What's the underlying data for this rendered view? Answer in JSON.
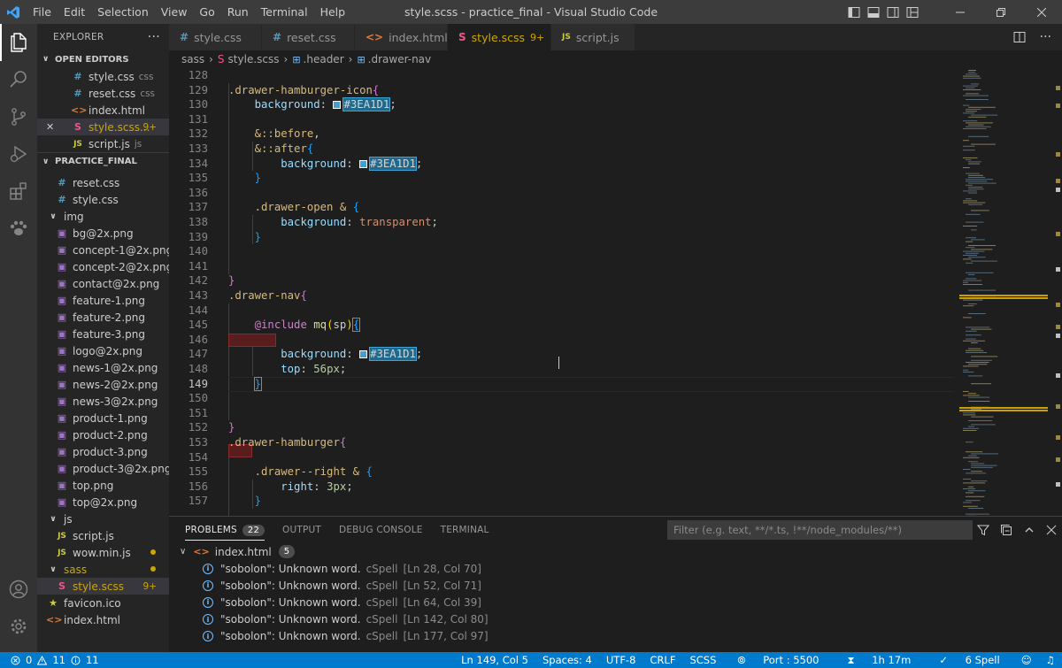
{
  "menu": [
    "File",
    "Edit",
    "Selection",
    "View",
    "Go",
    "Run",
    "Terminal",
    "Help"
  ],
  "window_title": "style.scss - practice_final - Visual Studio Code",
  "explorer": {
    "title": "EXPLORER",
    "more": "···",
    "open_editors_label": "OPEN EDITORS",
    "open_editors": [
      {
        "icon": "#",
        "name": "style.css",
        "sub": "css",
        "type": "css"
      },
      {
        "icon": "#",
        "name": "reset.css",
        "sub": "css",
        "type": "css"
      },
      {
        "icon": "<>",
        "name": "index.html",
        "sub": "",
        "type": "html"
      },
      {
        "icon": "S",
        "name": "style.scss...",
        "sub": "",
        "type": "sass",
        "badge": "9+",
        "close": "✕"
      },
      {
        "icon": "JS",
        "name": "script.js",
        "sub": "js",
        "type": "js"
      }
    ],
    "project_label": "PRACTICE_FINAL",
    "files": [
      {
        "icon": "#",
        "name": "reset.css",
        "type": "css",
        "indent": 1
      },
      {
        "icon": "#",
        "name": "style.css",
        "type": "css",
        "indent": 1
      },
      {
        "icon": "∨",
        "name": "img",
        "type": "folder",
        "indent": 0
      },
      {
        "icon": "▣",
        "name": "bg@2x.png",
        "type": "img",
        "indent": 1
      },
      {
        "icon": "▣",
        "name": "concept-1@2x.png",
        "type": "img",
        "indent": 1
      },
      {
        "icon": "▣",
        "name": "concept-2@2x.png",
        "type": "img",
        "indent": 1
      },
      {
        "icon": "▣",
        "name": "contact@2x.png",
        "type": "img",
        "indent": 1
      },
      {
        "icon": "▣",
        "name": "feature-1.png",
        "type": "img",
        "indent": 1
      },
      {
        "icon": "▣",
        "name": "feature-2.png",
        "type": "img",
        "indent": 1
      },
      {
        "icon": "▣",
        "name": "feature-3.png",
        "type": "img",
        "indent": 1
      },
      {
        "icon": "▣",
        "name": "logo@2x.png",
        "type": "img",
        "indent": 1
      },
      {
        "icon": "▣",
        "name": "news-1@2x.png",
        "type": "img",
        "indent": 1
      },
      {
        "icon": "▣",
        "name": "news-2@2x.png",
        "type": "img",
        "indent": 1
      },
      {
        "icon": "▣",
        "name": "news-3@2x.png",
        "type": "img",
        "indent": 1
      },
      {
        "icon": "▣",
        "name": "product-1.png",
        "type": "img",
        "indent": 1
      },
      {
        "icon": "▣",
        "name": "product-2.png",
        "type": "img",
        "indent": 1
      },
      {
        "icon": "▣",
        "name": "product-3.png",
        "type": "img",
        "indent": 1
      },
      {
        "icon": "▣",
        "name": "product-3@2x.png",
        "type": "img",
        "indent": 1
      },
      {
        "icon": "▣",
        "name": "top.png",
        "type": "img",
        "indent": 1
      },
      {
        "icon": "▣",
        "name": "top@2x.png",
        "type": "img",
        "indent": 1
      },
      {
        "icon": "∨",
        "name": "js",
        "type": "folder",
        "indent": 0
      },
      {
        "icon": "JS",
        "name": "script.js",
        "type": "js",
        "indent": 1
      },
      {
        "icon": "JS",
        "name": "wow.min.js",
        "type": "js",
        "indent": 1,
        "dot": true
      },
      {
        "icon": "∨",
        "name": "sass",
        "type": "folder",
        "indent": 0,
        "warn": true
      },
      {
        "icon": "S",
        "name": "style.scss",
        "type": "sass",
        "indent": 1,
        "badge": "9+",
        "selected": true
      },
      {
        "icon": "★",
        "name": "favicon.ico",
        "type": "star",
        "indent": 0
      },
      {
        "icon": "<>",
        "name": "index.html",
        "type": "html",
        "indent": 0
      }
    ]
  },
  "tabs": [
    {
      "icon": "#",
      "label": "style.css",
      "type": "css"
    },
    {
      "icon": "#",
      "label": "reset.css",
      "type": "css"
    },
    {
      "icon": "<>",
      "label": "index.html",
      "type": "html"
    },
    {
      "icon": "S",
      "label": "style.scss",
      "type": "sass",
      "badge": "9+",
      "active": true
    },
    {
      "icon": "JS",
      "label": "script.js",
      "type": "js"
    }
  ],
  "breadcrumb": [
    "sass",
    "style.scss",
    ".header",
    ".drawer-nav"
  ],
  "code_lines": [
    {
      "n": "128",
      "html": ""
    },
    {
      "n": "129",
      "html": "<span class='t-sel'>.drawer-hamburger-icon</span><span class='t-br'>{</span>"
    },
    {
      "n": "130",
      "html": "    <span class='t-prop'>background</span><span class='t-pl'>: </span><span class='swatch'></span><span class='hex'>#3EA1D1</span><span class='t-pl'>;</span>"
    },
    {
      "n": "131",
      "html": ""
    },
    {
      "n": "132",
      "html": "    <span class='t-sel'>&amp;::before</span><span class='t-pl'>,</span>"
    },
    {
      "n": "133",
      "html": "    <span class='t-sel'>&amp;::after</span><span class='t-br2'>{</span>"
    },
    {
      "n": "134",
      "html": "        <span class='t-prop'>background</span><span class='t-pl'>: </span><span class='swatch'></span><span class='hex'>#3EA1D1</span><span class='t-pl'>;</span>"
    },
    {
      "n": "135",
      "html": "    <span class='t-br2'>}</span>"
    },
    {
      "n": "136",
      "html": ""
    },
    {
      "n": "137",
      "html": "    <span class='t-sel'>.drawer-open &amp; </span><span class='t-br2'>{</span>"
    },
    {
      "n": "138",
      "html": "        <span class='t-prop'>background</span><span class='t-pl'>: </span><span class='t-val'>transparent</span><span class='t-pl'>;</span>"
    },
    {
      "n": "139",
      "html": "    <span class='t-br2'>}</span>"
    },
    {
      "n": "140",
      "html": ""
    },
    {
      "n": "141",
      "html": ""
    },
    {
      "n": "142",
      "html": "<span class='t-br'>}</span>"
    },
    {
      "n": "143",
      "html": "<span class='t-sel'>.drawer-nav</span><span class='t-br'>{</span>"
    },
    {
      "n": "144",
      "html": ""
    },
    {
      "n": "145",
      "html": "    <span class='t-kw'>@include</span><span class='t-pl'> </span><span class='t-fn'>mq</span><span class='t-br3'>(</span><span class='t-pl'>sp</span><span class='t-br3'>)</span><span class='t-br2' style='outline:1px solid #888'>{</span>"
    },
    {
      "n": "146",
      "html": ""
    },
    {
      "n": "147",
      "html": "        <span class='t-prop'>background</span><span class='t-pl'>: </span><span class='swatch'></span><span class='hex'>#3EA1D1</span><span class='t-pl'>;</span>"
    },
    {
      "n": "148",
      "html": "        <span class='t-prop'>top</span><span class='t-pl'>: </span><span class='t-num'>56px</span><span class='t-pl'>;</span>"
    },
    {
      "n": "149",
      "html": "    <span class='t-br2' style='outline:1px solid #888'>}</span>"
    },
    {
      "n": "150",
      "html": ""
    },
    {
      "n": "151",
      "html": ""
    },
    {
      "n": "152",
      "html": "<span class='t-br'>}</span>"
    },
    {
      "n": "153",
      "html": "<span class='t-sel'>.drawer-hamburger</span><span class='t-br'>{</span>"
    },
    {
      "n": "154",
      "html": ""
    },
    {
      "n": "155",
      "html": "    <span class='t-sel'>.drawer--right &amp; </span><span class='t-br2'>{</span>"
    },
    {
      "n": "156",
      "html": "        <span class='t-prop'>right</span><span class='t-pl'>: </span><span class='t-num'>3px</span><span class='t-pl'>;</span>"
    },
    {
      "n": "157",
      "html": "    <span class='t-br2'>}</span>"
    }
  ],
  "current_line": "149",
  "panel": {
    "tabs": [
      {
        "label": "PROBLEMS",
        "badge": "22",
        "active": true
      },
      {
        "label": "OUTPUT"
      },
      {
        "label": "DEBUG CONSOLE"
      },
      {
        "label": "TERMINAL"
      }
    ],
    "filter_placeholder": "Filter (e.g. text, **/*.ts, !**/node_modules/**)",
    "file": "index.html",
    "file_count": "5",
    "problems": [
      {
        "msg": "\"sobolon\": Unknown word.",
        "src": "cSpell",
        "loc": "[Ln 28, Col 70]"
      },
      {
        "msg": "\"sobolon\": Unknown word.",
        "src": "cSpell",
        "loc": "[Ln 52, Col 71]"
      },
      {
        "msg": "\"sobolon\": Unknown word.",
        "src": "cSpell",
        "loc": "[Ln 64, Col 39]"
      },
      {
        "msg": "\"sobolon\": Unknown word.",
        "src": "cSpell",
        "loc": "[Ln 142, Col 80]"
      },
      {
        "msg": "\"sobolon\": Unknown word.",
        "src": "cSpell",
        "loc": "[Ln 177, Col 97]"
      }
    ]
  },
  "status": {
    "errors": "0",
    "warnings": "11",
    "infos": "11",
    "position": "Ln 149, Col 5",
    "spaces": "Spaces: 4",
    "encoding": "UTF-8",
    "eol": "CRLF",
    "language": "SCSS",
    "port": "Port : 5500",
    "time": "1h 17m",
    "spell": "6 Spell"
  },
  "colors": {
    "accent": "#007acc",
    "warning": "#cca700",
    "swatch": "#3EA1D1"
  }
}
